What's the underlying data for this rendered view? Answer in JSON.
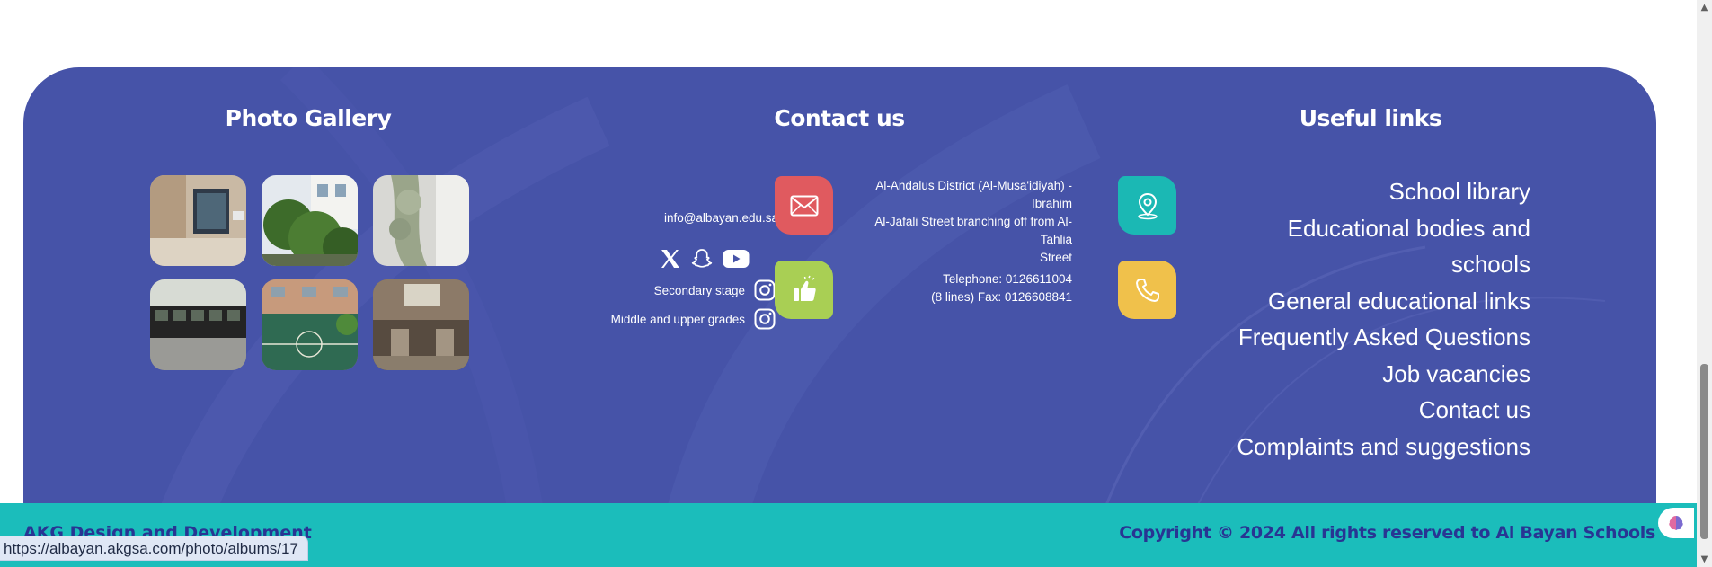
{
  "gallery": {
    "title": "Photo Gallery",
    "photos": [
      "hallway-photo",
      "garden-photo",
      "courtyard-photo",
      "computer-lab-photo",
      "basketball-court-photo",
      "atrium-photo"
    ]
  },
  "contact": {
    "title": "Contact us",
    "email": "info@albayan.edu.sa",
    "address_line1": "Al-Andalus District (Al-Musa'idiyah) - Ibrahim",
    "address_line2": "Al-Jafali Street branching off from Al-Tahlia",
    "address_line3": "Street",
    "phone_line1": "Telephone: 0126611004",
    "phone_line2": "(8 lines) Fax: 0126608841",
    "instagram_secondary": "Secondary stage",
    "instagram_middle": "Middle and upper grades",
    "colors": {
      "mail": "#e05a5f",
      "location": "#1bb8b4",
      "like": "#a9cf54",
      "phone": "#f0c14b"
    }
  },
  "links": {
    "title": "Useful links",
    "items": [
      "School library",
      "Educational bodies and",
      "schools",
      "General educational links",
      "Frequently Asked Questions",
      "Job vacancies",
      "Contact us",
      "Complaints and suggestions"
    ]
  },
  "bottom": {
    "credit": "AKG Design and Development",
    "copyright": "Copyright © 2024 All rights reserved to Al Bayan Schools"
  },
  "status_url": "https://albayan.akgsa.com/photo/albums/17",
  "theme": {
    "panel": "#4653a8",
    "bar": "#1bbdbb",
    "bar_text": "#283593"
  }
}
